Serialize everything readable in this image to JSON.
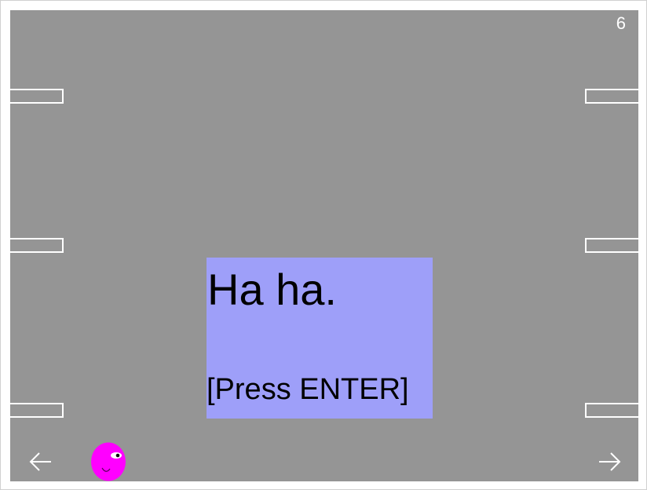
{
  "game": {
    "level_number": "6",
    "dialog": {
      "message": "Ha ha.",
      "prompt": "[Press ENTER]"
    },
    "colors": {
      "stage_background": "#959595",
      "dialog_background": "#9e9ff9",
      "player_body": "#ff00ff",
      "ledge_outline": "#ffffff"
    },
    "icons": {
      "nav_left": "arrow-left-icon",
      "nav_right": "arrow-right-icon",
      "player": "player-character"
    }
  }
}
